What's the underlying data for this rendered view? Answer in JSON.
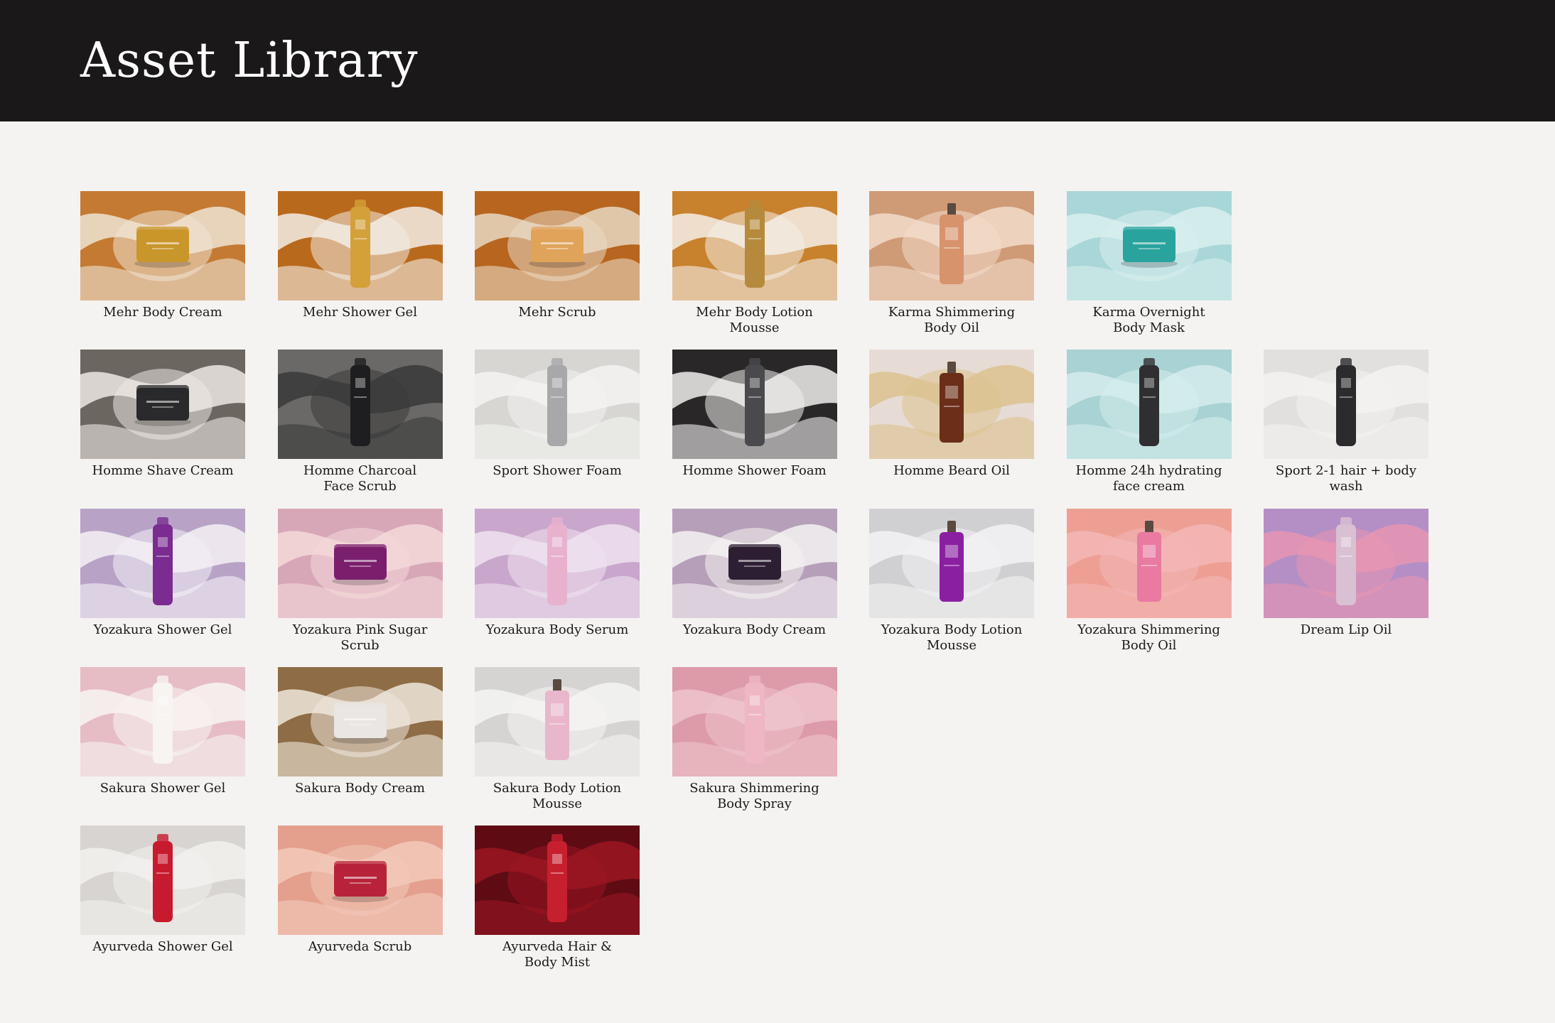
{
  "header": {
    "title": "Asset Library"
  },
  "assets": [
    {
      "label": "Mehr Body Cream",
      "bg": "#c47a32",
      "accent": "#efe3d4",
      "product": "jar",
      "color": "#c9962b"
    },
    {
      "label": "Mehr Shower Gel",
      "bg": "#b9691c",
      "accent": "#f3ede6",
      "product": "tube",
      "color": "#d3a03a"
    },
    {
      "label": "Mehr Scrub",
      "bg": "#b7651f",
      "accent": "#e9d8c2",
      "product": "jar",
      "color": "#e0a35a"
    },
    {
      "label": "Mehr Body Lotion Mousse",
      "bg": "#c8812c",
      "accent": "#f4efe8",
      "product": "tube",
      "color": "#b58a3c"
    },
    {
      "label": "Karma Shimmering\nBody Oil",
      "bg": "#cf9a76",
      "accent": "#f2dccb",
      "product": "bottle",
      "color": "#d7936c"
    },
    {
      "label": "Karma Overnight\nBody Mask",
      "bg": "#a9d6d8",
      "accent": "#d9efef",
      "product": "jar",
      "color": "#2aa39e"
    },
    {
      "label": "Homme Shave Cream",
      "bg": "#6c6661",
      "accent": "#ece8e3",
      "product": "jar",
      "color": "#2a2a2c"
    },
    {
      "label": "Homme Charcoal\nFace Scrub",
      "bg": "#6a6967",
      "accent": "#3a3a3a",
      "product": "tube",
      "color": "#1e1e20"
    },
    {
      "label": "Sport Shower Foam",
      "bg": "#d8d6d3",
      "accent": "#f4f3f2",
      "product": "tube",
      "color": "#a8a8ab"
    },
    {
      "label": "Homme Shower Foam",
      "bg": "#2a2729",
      "accent": "#f0eeec",
      "product": "tube",
      "color": "#4a4a4e"
    },
    {
      "label": "Homme Beard Oil",
      "bg": "#e6dcd5",
      "accent": "#dcc28f",
      "product": "bottle",
      "color": "#6b2e18"
    },
    {
      "label": "Homme 24h hydrating\nface cream",
      "bg": "#a8d2d3",
      "accent": "#d5ecec",
      "product": "tube",
      "color": "#2f2f31"
    },
    {
      "label": "Sport 2-1 hair + body wash",
      "bg": "#e2e0de",
      "accent": "#f3f2f1",
      "product": "tube",
      "color": "#2b2b2d"
    },
    {
      "label": "Yozakura Shower Gel",
      "bg": "#b8a3c7",
      "accent": "#f4f1f5",
      "product": "tube",
      "color": "#7a2c90"
    },
    {
      "label": "Yozakura Pink Sugar Scrub",
      "bg": "#d7a7b8",
      "accent": "#f4d8d8",
      "product": "jar",
      "color": "#7b1f6d"
    },
    {
      "label": "Yozakura Body Serum",
      "bg": "#c9a6cc",
      "accent": "#efe2ef",
      "product": "tube",
      "color": "#e8b2cf"
    },
    {
      "label": "Yozakura Body Cream",
      "bg": "#b59fb9",
      "accent": "#f5f2f2",
      "product": "jar",
      "color": "#2d1f33"
    },
    {
      "label": "Yozakura Body Lotion\nMousse",
      "bg": "#d0d0d3",
      "accent": "#f3f3f4",
      "product": "bottle",
      "color": "#8b1fa1"
    },
    {
      "label": "Yozakura Shimmering\nBody Oil",
      "bg": "#ee9f94",
      "accent": "#f3b7b6",
      "product": "bottle",
      "color": "#e97aa0"
    },
    {
      "label": "Dream Lip Oil",
      "bg": "#b48fc6",
      "accent": "#e795b1",
      "product": "tube",
      "color": "#d9c0d2"
    },
    {
      "label": "Sakura Shower Gel",
      "bg": "#e6bcc5",
      "accent": "#f7f4f2",
      "product": "tube",
      "color": "#f7f4f2"
    },
    {
      "label": "Sakura Body Cream",
      "bg": "#8e6c45",
      "accent": "#efe7dc",
      "product": "jar",
      "color": "#e9e6e3"
    },
    {
      "label": "Sakura Body Lotion\nMousse",
      "bg": "#d6d4d3",
      "accent": "#f5f4f3",
      "product": "bottle",
      "color": "#e8b7cc"
    },
    {
      "label": "Sakura Shimmering\nBody Spray",
      "bg": "#dd9aa9",
      "accent": "#efc4cc",
      "product": "tube",
      "color": "#efb6c4"
    },
    {
      "label": "Ayurveda Shower Gel",
      "bg": "#d7d4d1",
      "accent": "#f2f1ef",
      "product": "tube",
      "color": "#c81a2e"
    },
    {
      "label": "Ayurveda Scrub",
      "bg": "#e4a08d",
      "accent": "#f3c9ba",
      "product": "jar",
      "color": "#b8233a"
    },
    {
      "label": "Ayurveda Hair &\nBody Mist",
      "bg": "#5e0b14",
      "accent": "#9a1621",
      "product": "tube",
      "color": "#c61f2e"
    }
  ]
}
